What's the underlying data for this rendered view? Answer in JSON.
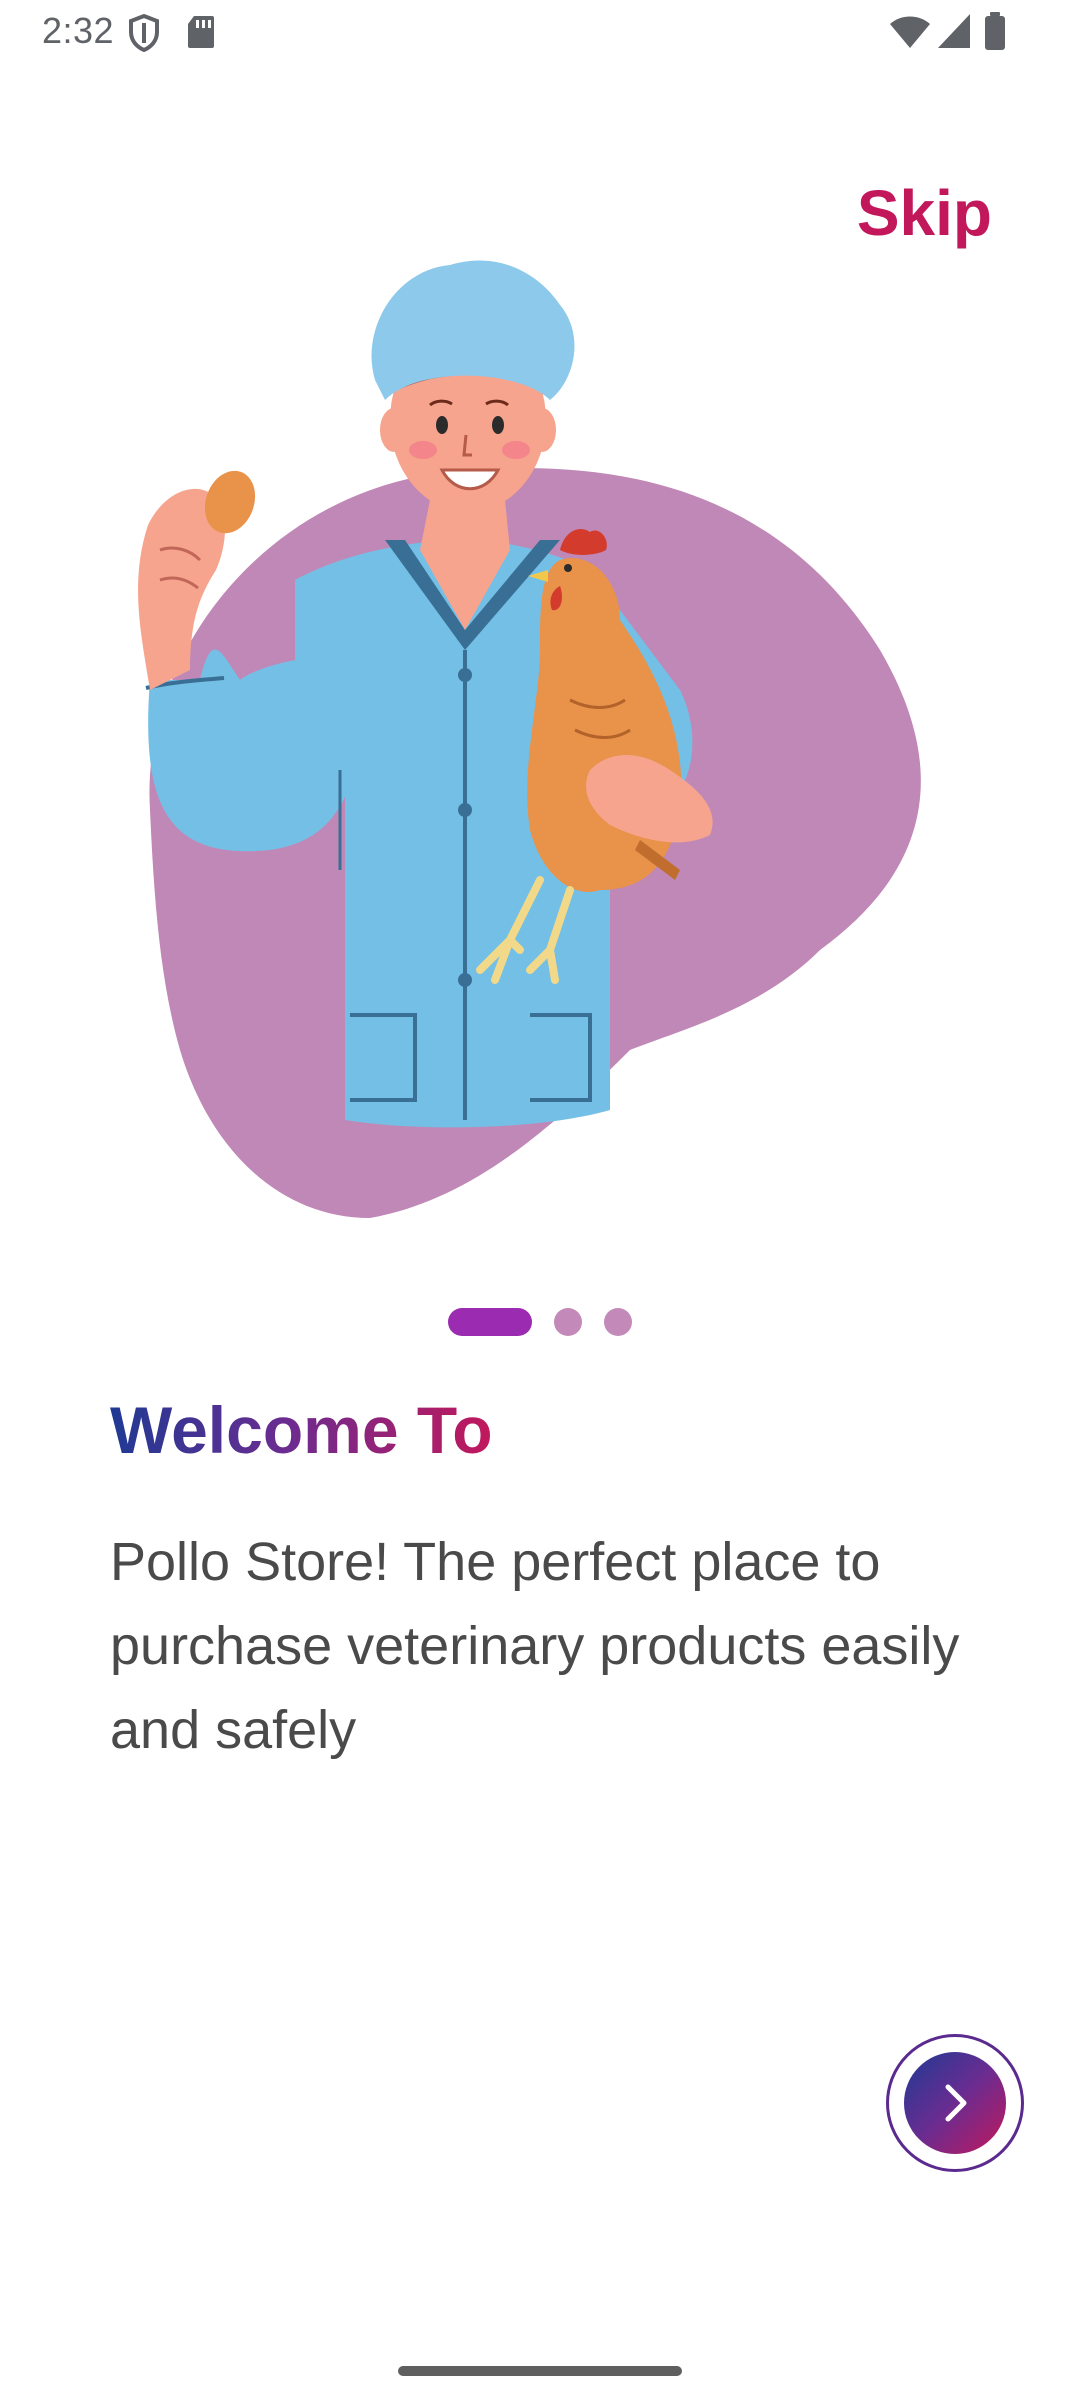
{
  "status_bar": {
    "time": "2:32",
    "icons": [
      "shield-icon",
      "sd-card-icon",
      "wifi-icon",
      "cell-signal-icon",
      "battery-icon"
    ]
  },
  "onboarding": {
    "skip_label": "Skip",
    "illustration": "veterinarian-holding-egg-and-chicken",
    "page_indicator": {
      "total_pages": 3,
      "current_page": 1
    },
    "title": "Welcome To",
    "description": "Pollo Store! The perfect place to purchase veterinary products easily and safely",
    "next_button_icon": "chevron-right-icon"
  },
  "colors": {
    "brand_magenta": "#c2185b",
    "brand_navy": "#1f3a93",
    "brand_purple": "#6a2c91",
    "indicator_active": "#9b2bb0",
    "indicator_inactive": "#c389b8",
    "blob": "#c088b6",
    "body_text": "#4a4a4a"
  }
}
